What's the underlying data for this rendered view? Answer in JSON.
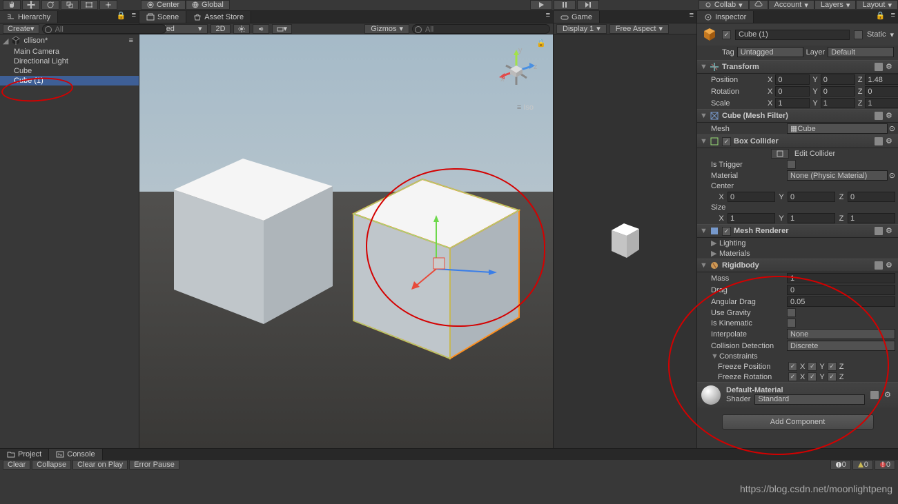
{
  "topbar": {
    "center": "Center",
    "global": "Global",
    "collab": "Collab",
    "account": "Account",
    "layers": "Layers",
    "layout": "Layout"
  },
  "hierarchy": {
    "tab": "Hierarchy",
    "create": "Create",
    "search_ph": "All",
    "scene": "cllison*",
    "items": [
      "Main Camera",
      "Directional Light",
      "Cube",
      "Cube (1)"
    ]
  },
  "scene": {
    "tab_scene": "Scene",
    "tab_asset": "Asset Store",
    "shaded": "Shaded",
    "mode2d": "2D",
    "gizmos": "Gizmos",
    "search_ph": "All",
    "iso": "Iso"
  },
  "game": {
    "tab": "Game",
    "display": "Display 1",
    "aspect": "Free Aspect"
  },
  "inspector": {
    "tab": "Inspector",
    "name": "Cube (1)",
    "static": "Static",
    "tag_label": "Tag",
    "tag_value": "Untagged",
    "layer_label": "Layer",
    "layer_value": "Default",
    "transform": {
      "title": "Transform",
      "position": "Position",
      "rotation": "Rotation",
      "scale": "Scale",
      "px": "0",
      "py": "0",
      "pz": "1.48",
      "rx": "0",
      "ry": "0",
      "rz": "0",
      "sx": "1",
      "sy": "1",
      "sz": "1"
    },
    "meshfilter": {
      "title": "Cube (Mesh Filter)",
      "mesh_label": "Mesh",
      "mesh_value": "Cube"
    },
    "boxcollider": {
      "title": "Box Collider",
      "edit": "Edit Collider",
      "trigger": "Is Trigger",
      "material_label": "Material",
      "material_value": "None (Physic Material)",
      "center": "Center",
      "cx": "0",
      "cy": "0",
      "cz": "0",
      "size": "Size",
      "sxv": "1",
      "syv": "1",
      "szv": "1"
    },
    "meshrenderer": {
      "title": "Mesh Renderer",
      "lighting": "Lighting",
      "materials": "Materials"
    },
    "rigidbody": {
      "title": "Rigidbody",
      "mass_label": "Mass",
      "mass": "1",
      "drag_label": "Drag",
      "drag": "0",
      "angdrag_label": "Angular Drag",
      "angdrag": "0.05",
      "gravity": "Use Gravity",
      "kinematic": "Is Kinematic",
      "interpolate_label": "Interpolate",
      "interpolate": "None",
      "collision_label": "Collision Detection",
      "collision": "Discrete",
      "constraints": "Constraints",
      "freezepos": "Freeze Position",
      "freezerot": "Freeze Rotation"
    },
    "material": {
      "name": "Default-Material",
      "shader_label": "Shader",
      "shader": "Standard"
    },
    "add_component": "Add Component"
  },
  "bottom": {
    "project": "Project",
    "console": "Console",
    "clear": "Clear",
    "collapse": "Collapse",
    "clearplay": "Clear on Play",
    "errorpause": "Error Pause",
    "count0": "0"
  },
  "axes": {
    "x": "X",
    "y": "Y",
    "z": "Z"
  },
  "watermark": "https://blog.csdn.net/moonlightpeng"
}
